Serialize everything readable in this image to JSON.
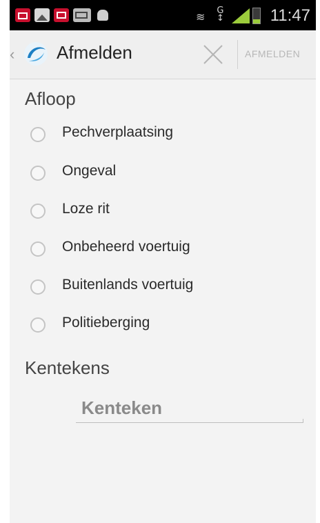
{
  "status_bar": {
    "time": "11:47",
    "notification_icons": [
      "calendar-icon",
      "gallery-icon",
      "mail-icon",
      "sms-icon",
      "android-icon"
    ],
    "system_icons": [
      "mute-icon",
      "gprs-icon",
      "signal-icon",
      "battery-icon"
    ]
  },
  "action_bar": {
    "title": "Afmelden",
    "action_label": "AFMELDEN",
    "close_icon": "close-icon"
  },
  "afloop": {
    "heading": "Afloop",
    "options": [
      {
        "label": "Pechverplaatsing",
        "selected": false
      },
      {
        "label": "Ongeval",
        "selected": false
      },
      {
        "label": "Loze rit",
        "selected": false
      },
      {
        "label": "Onbeheerd voertuig",
        "selected": false
      },
      {
        "label": "Buitenlands voertuig",
        "selected": false
      },
      {
        "label": "Politieberging",
        "selected": false
      }
    ]
  },
  "kentekens": {
    "heading": "Kentekens",
    "input_value": "",
    "input_placeholder": "Kenteken"
  }
}
